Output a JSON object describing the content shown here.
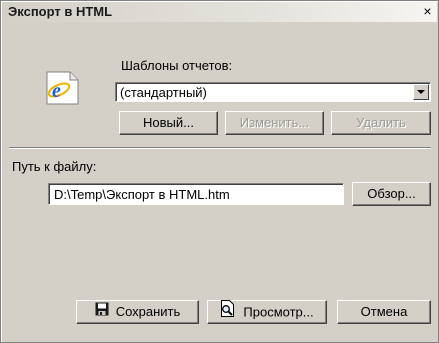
{
  "window": {
    "title": "Экспорт в HTML",
    "close_glyph": "×"
  },
  "templates": {
    "label": "Шаблоны отчетов:",
    "selected": "(стандартный)",
    "new_label": "Новый...",
    "edit_label": "Изменить...",
    "delete_label": "Удалить"
  },
  "file": {
    "label": "Путь к файлу:",
    "path": "D:\\Temp\\Экспорт в HTML.htm",
    "browse_label": "Обзор..."
  },
  "actions": {
    "save_label": "Сохранить",
    "preview_label": "Просмотр...",
    "cancel_label": "Отмена"
  },
  "icons": {
    "app": "internet-explorer-icon",
    "save": "floppy-disk-icon",
    "preview": "print-preview-icon"
  },
  "colors": {
    "dialog_bg": "#d4d0c8",
    "ie_blue": "#1d5fd1",
    "disabled_text": "#9c9a94"
  }
}
